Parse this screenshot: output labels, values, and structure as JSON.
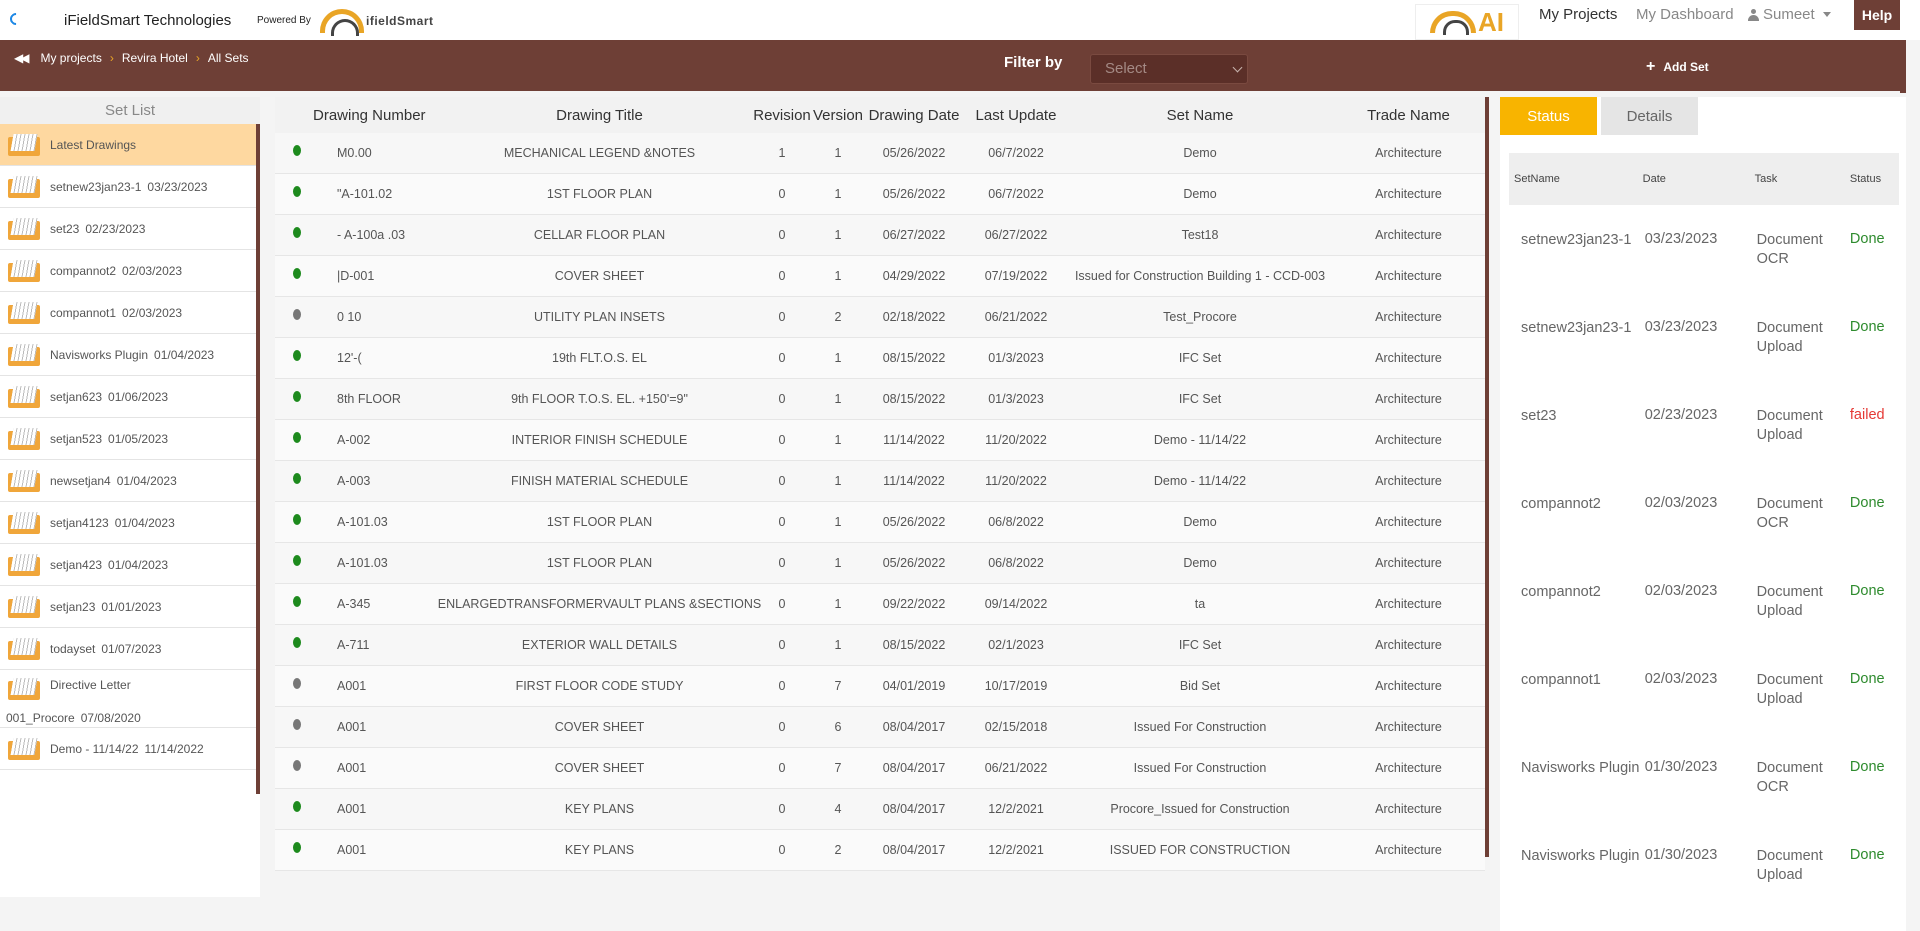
{
  "header": {
    "company": "iFieldSmart Technologies",
    "powered_by": "Powered By",
    "brand_logo_text": "ifieldSmart",
    "ai_logo_text": "AI",
    "nav": {
      "my_projects": "My Projects",
      "my_dashboard": "My Dashboard",
      "user": "Sumeet"
    },
    "help": "Help"
  },
  "toolbar": {
    "breadcrumbs": [
      "My projects",
      "Revira Hotel",
      "All Sets"
    ],
    "filter_label": "Filter by",
    "filter_value": "Select",
    "add_set": "Add Set"
  },
  "set_list": {
    "title": "Set List",
    "items": [
      {
        "name": "Latest Drawings",
        "date": ""
      },
      {
        "name": "setnew23jan23-1",
        "date": "03/23/2023"
      },
      {
        "name": "set23",
        "date": "02/23/2023"
      },
      {
        "name": "compannot2",
        "date": "02/03/2023"
      },
      {
        "name": "compannot1",
        "date": "02/03/2023"
      },
      {
        "name": "Navisworks Plugin",
        "date": "01/04/2023"
      },
      {
        "name": "setjan623",
        "date": "01/06/2023"
      },
      {
        "name": "setjan523",
        "date": "01/05/2023"
      },
      {
        "name": "newsetjan4",
        "date": "01/04/2023"
      },
      {
        "name": "setjan4123",
        "date": "01/04/2023"
      },
      {
        "name": "setjan423",
        "date": "01/04/2023"
      },
      {
        "name": "setjan23",
        "date": "01/01/2023"
      },
      {
        "name": "todayset",
        "date": "01/07/2023"
      },
      {
        "name": "Directive Letter",
        "cont": "001_Procore",
        "date": "07/08/2020"
      },
      {
        "name": "Demo - 11/14/22",
        "date": "11/14/2022"
      }
    ]
  },
  "table": {
    "headers": [
      "Drawing Number",
      "Drawing Title",
      "Revision",
      "Version",
      "Drawing Date",
      "Last Update",
      "Set Name",
      "Trade Name"
    ],
    "rows": [
      {
        "status": "green",
        "number": "M0.00",
        "title": "MECHANICAL LEGEND &NOTES",
        "rev": "1",
        "ver": "1",
        "ddate": "05/26/2022",
        "updated": "06/7/2022",
        "set": "Demo",
        "trade": "Architecture"
      },
      {
        "status": "green",
        "number": "\"A-101.02",
        "title": "1ST FLOOR PLAN",
        "rev": "0",
        "ver": "1",
        "ddate": "05/26/2022",
        "updated": "06/7/2022",
        "set": "Demo",
        "trade": "Architecture"
      },
      {
        "status": "green",
        "number": "- A-100a .03",
        "title": "CELLAR FLOOR PLAN",
        "rev": "0",
        "ver": "1",
        "ddate": "06/27/2022",
        "updated": "06/27/2022",
        "set": "Test18",
        "trade": "Architecture"
      },
      {
        "status": "green",
        "number": "|D-001",
        "title": "COVER SHEET",
        "rev": "0",
        "ver": "1",
        "ddate": "04/29/2022",
        "updated": "07/19/2022",
        "set": "Issued for Construction Building 1 - CCD-003",
        "trade": "Architecture"
      },
      {
        "status": "gray",
        "number": "0 10",
        "title": "UTILITY PLAN INSETS",
        "rev": "0",
        "ver": "2",
        "ddate": "02/18/2022",
        "updated": "06/21/2022",
        "set": "Test_Procore",
        "trade": "Architecture"
      },
      {
        "status": "green",
        "number": "12'-(",
        "title": "19th FLT.O.S. EL",
        "rev": "0",
        "ver": "1",
        "ddate": "08/15/2022",
        "updated": "01/3/2023",
        "set": "IFC Set",
        "trade": "Architecture"
      },
      {
        "status": "green",
        "number": "8th FLOOR",
        "title": "9th FLOOR T.O.S. EL. +150'=9\"",
        "rev": "0",
        "ver": "1",
        "ddate": "08/15/2022",
        "updated": "01/3/2023",
        "set": "IFC Set",
        "trade": "Architecture"
      },
      {
        "status": "green",
        "number": "A-002",
        "title": "INTERIOR FINISH SCHEDULE",
        "rev": "0",
        "ver": "1",
        "ddate": "11/14/2022",
        "updated": "11/20/2022",
        "set": "Demo - 11/14/22",
        "trade": "Architecture"
      },
      {
        "status": "green",
        "number": "A-003",
        "title": "FINISH MATERIAL SCHEDULE",
        "rev": "0",
        "ver": "1",
        "ddate": "11/14/2022",
        "updated": "11/20/2022",
        "set": "Demo - 11/14/22",
        "trade": "Architecture"
      },
      {
        "status": "green",
        "number": "A-101.03",
        "title": "1ST FLOOR PLAN",
        "rev": "0",
        "ver": "1",
        "ddate": "05/26/2022",
        "updated": "06/8/2022",
        "set": "Demo",
        "trade": "Architecture"
      },
      {
        "status": "green",
        "number": "A-101.03",
        "title": "1ST FLOOR PLAN",
        "rev": "0",
        "ver": "1",
        "ddate": "05/26/2022",
        "updated": "06/8/2022",
        "set": "Demo",
        "trade": "Architecture"
      },
      {
        "status": "green",
        "number": "A-345",
        "title": "ENLARGEDTRANSFORMERVAULT PLANS &SECTIONS",
        "rev": "0",
        "ver": "1",
        "ddate": "09/22/2022",
        "updated": "09/14/2022",
        "set": "ta",
        "trade": "Architecture"
      },
      {
        "status": "green",
        "number": "A-711",
        "title": "EXTERIOR WALL DETAILS",
        "rev": "0",
        "ver": "1",
        "ddate": "08/15/2022",
        "updated": "02/1/2023",
        "set": "IFC Set",
        "trade": "Architecture"
      },
      {
        "status": "gray",
        "number": "A001",
        "title": "FIRST FLOOR CODE STUDY",
        "rev": "0",
        "ver": "7",
        "ddate": "04/01/2019",
        "updated": "10/17/2019",
        "set": "Bid Set",
        "trade": "Architecture"
      },
      {
        "status": "gray",
        "number": "A001",
        "title": "COVER SHEET",
        "rev": "0",
        "ver": "6",
        "ddate": "08/04/2017",
        "updated": "02/15/2018",
        "set": "Issued For Construction",
        "trade": "Architecture"
      },
      {
        "status": "gray",
        "number": "A001",
        "title": "COVER SHEET",
        "rev": "0",
        "ver": "7",
        "ddate": "08/04/2017",
        "updated": "06/21/2022",
        "set": "Issued For Construction",
        "trade": "Architecture"
      },
      {
        "status": "green",
        "number": "A001",
        "title": "KEY PLANS",
        "rev": "0",
        "ver": "4",
        "ddate": "08/04/2017",
        "updated": "12/2/2021",
        "set": "Procore_Issued for Construction",
        "trade": "Architecture"
      },
      {
        "status": "green",
        "number": "A001",
        "title": "KEY PLANS",
        "rev": "0",
        "ver": "2",
        "ddate": "08/04/2017",
        "updated": "12/2/2021",
        "set": "ISSUED FOR CONSTRUCTION",
        "trade": "Architecture"
      }
    ]
  },
  "status_panel": {
    "tabs": [
      "Status",
      "Details"
    ],
    "headers": [
      "SetName",
      "Date",
      "Task",
      "Status"
    ],
    "rows": [
      {
        "name": "setnew23jan23-1",
        "date": "03/23/2023",
        "task": "Document OCR",
        "status": "Done"
      },
      {
        "name": "setnew23jan23-1",
        "date": "03/23/2023",
        "task": "Document Upload",
        "status": "Done"
      },
      {
        "name": "set23",
        "date": "02/23/2023",
        "task": "Document Upload",
        "status": "failed"
      },
      {
        "name": "compannot2",
        "date": "02/03/2023",
        "task": "Document OCR",
        "status": "Done"
      },
      {
        "name": "compannot2",
        "date": "02/03/2023",
        "task": "Document Upload",
        "status": "Done"
      },
      {
        "name": "compannot1",
        "date": "02/03/2023",
        "task": "Document Upload",
        "status": "Done"
      },
      {
        "name": "Navisworks Plugin",
        "date": "01/30/2023",
        "task": "Document OCR",
        "status": "Done"
      },
      {
        "name": "Navisworks Plugin",
        "date": "01/30/2023",
        "task": "Document Upload",
        "status": "Done"
      }
    ]
  },
  "colors": {
    "brand_brown": "#6e3f36",
    "accent_orange": "#f8b400",
    "status_green": "#1d8a1d",
    "status_gray": "#777777",
    "status_failed": "#e53935"
  },
  "icons": [
    "back-spinner-icon",
    "brand-logo-icon",
    "user-icon",
    "caret-down-icon",
    "double-chevron-left-icon",
    "plus-icon",
    "folder-icon",
    "status-dot-icon"
  ]
}
